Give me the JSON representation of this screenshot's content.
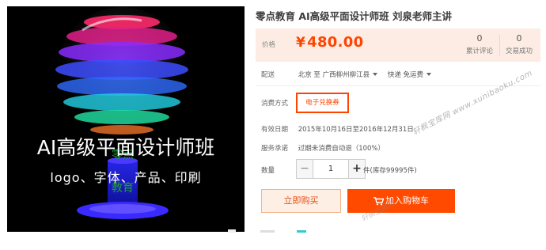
{
  "product_image": {
    "headline": "AI高级平面设计师班",
    "subline": "logo、字体、产品、印刷",
    "overlay_text": "零点教育"
  },
  "product": {
    "title": "零点教育 AI高级平面设计师班 刘泉老师主讲",
    "price_label": "价格",
    "currency": "¥",
    "price": "480.00",
    "reviews_count": "0",
    "reviews_label": "累计评论",
    "sales_count": "0",
    "sales_label": "交易成功"
  },
  "shipping": {
    "label": "配送",
    "from": "北京 至",
    "to": "广西柳州柳江县",
    "method": "快递 免运费"
  },
  "consume": {
    "label": "消费方式",
    "option": "电子兑换券"
  },
  "validity": {
    "label": "有效日期",
    "value": "2015年10月16日至2016年12月31日"
  },
  "commitment": {
    "label": "服务承诺",
    "value": "过期未消费自动退（100%）"
  },
  "quantity": {
    "label": "数量",
    "value": "1",
    "minus": "−",
    "plus": "+",
    "stock": "件(库存99995件)"
  },
  "actions": {
    "buy_now": "立即购买",
    "add_to_cart": "加入购物车"
  },
  "watermark": {
    "site": "轩枫宝库网 www.xunibaoku.com",
    "site2": "轩枫宝库网"
  },
  "colors": {
    "accent": "#ff4400",
    "price_bg": "#fcece3",
    "cart_button": "#ff4a00"
  }
}
